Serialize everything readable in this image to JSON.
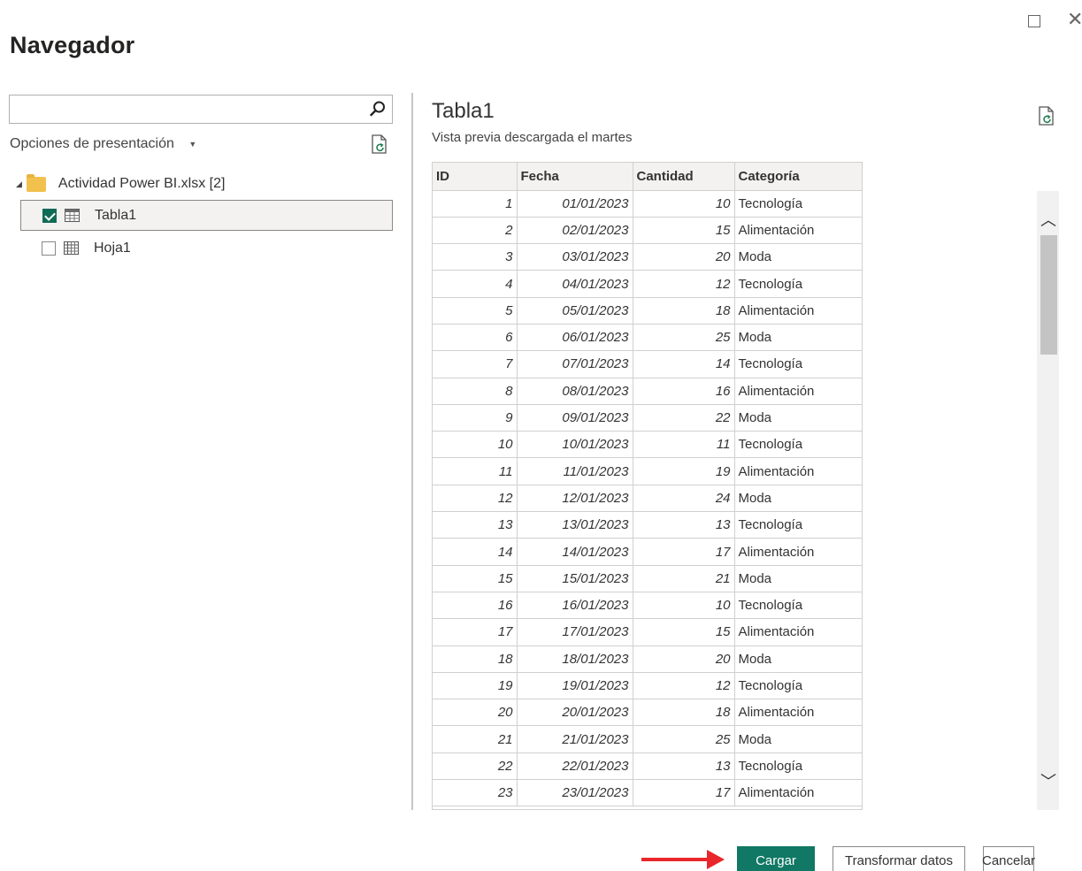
{
  "window": {
    "title": "Navegador",
    "maximize_icon": "maximize-icon",
    "close_icon": "close-icon"
  },
  "left_pane": {
    "search": {
      "value": "",
      "placeholder": ""
    },
    "display_options_label": "Opciones de presentación",
    "tree": {
      "folder_label": "Actividad Power BI.xlsx [2]",
      "items": [
        {
          "label": "Tabla1",
          "checked": true,
          "selected": true,
          "icon": "table-icon"
        },
        {
          "label": "Hoja1",
          "checked": false,
          "selected": false,
          "icon": "sheet-icon"
        }
      ]
    }
  },
  "preview": {
    "title": "Tabla1",
    "subtitle": "Vista previa descargada el martes",
    "columns": [
      "ID",
      "Fecha",
      "Cantidad",
      "Categoría"
    ],
    "rows": [
      [
        "1",
        "01/01/2023",
        "10",
        "Tecnología"
      ],
      [
        "2",
        "02/01/2023",
        "15",
        "Alimentación"
      ],
      [
        "3",
        "03/01/2023",
        "20",
        "Moda"
      ],
      [
        "4",
        "04/01/2023",
        "12",
        "Tecnología"
      ],
      [
        "5",
        "05/01/2023",
        "18",
        "Alimentación"
      ],
      [
        "6",
        "06/01/2023",
        "25",
        "Moda"
      ],
      [
        "7",
        "07/01/2023",
        "14",
        "Tecnología"
      ],
      [
        "8",
        "08/01/2023",
        "16",
        "Alimentación"
      ],
      [
        "9",
        "09/01/2023",
        "22",
        "Moda"
      ],
      [
        "10",
        "10/01/2023",
        "11",
        "Tecnología"
      ],
      [
        "11",
        "11/01/2023",
        "19",
        "Alimentación"
      ],
      [
        "12",
        "12/01/2023",
        "24",
        "Moda"
      ],
      [
        "13",
        "13/01/2023",
        "13",
        "Tecnología"
      ],
      [
        "14",
        "14/01/2023",
        "17",
        "Alimentación"
      ],
      [
        "15",
        "15/01/2023",
        "21",
        "Moda"
      ],
      [
        "16",
        "16/01/2023",
        "10",
        "Tecnología"
      ],
      [
        "17",
        "17/01/2023",
        "15",
        "Alimentación"
      ],
      [
        "18",
        "18/01/2023",
        "20",
        "Moda"
      ],
      [
        "19",
        "19/01/2023",
        "12",
        "Tecnología"
      ],
      [
        "20",
        "20/01/2023",
        "18",
        "Alimentación"
      ],
      [
        "21",
        "21/01/2023",
        "25",
        "Moda"
      ],
      [
        "22",
        "22/01/2023",
        "13",
        "Tecnología"
      ],
      [
        "23",
        "23/01/2023",
        "17",
        "Alimentación"
      ]
    ]
  },
  "buttons": {
    "load": "Cargar",
    "transform": "Transformar datos",
    "cancel": "Cancelar"
  },
  "colors": {
    "accent": "#117865",
    "annotation_arrow": "#e8262b"
  }
}
